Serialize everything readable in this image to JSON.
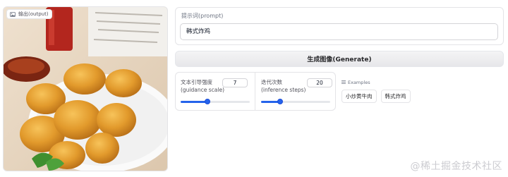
{
  "output": {
    "label": "输出(output)",
    "label_icon": "image-icon",
    "image_subject": "fried chicken drumsticks"
  },
  "prompt": {
    "label": "提示词(prompt)",
    "value": "韩式炸鸡"
  },
  "generate_button": {
    "label": "生成图像(Generate)"
  },
  "sliders": [
    {
      "label": "文本引导强度(guidance scale)",
      "value": "7",
      "level": 0.39
    },
    {
      "label": "迭代次数(inference steps)",
      "value": "20",
      "level": 0.28
    }
  ],
  "examples": {
    "label": "Examples",
    "icon": "list-icon",
    "items": [
      "小炒黄牛肉",
      "韩式炸鸡"
    ]
  },
  "watermark": {
    "text": "@稀土掘金技术社区"
  },
  "colors": {
    "accent": "#2563eb",
    "border": "#e4e4e7"
  }
}
